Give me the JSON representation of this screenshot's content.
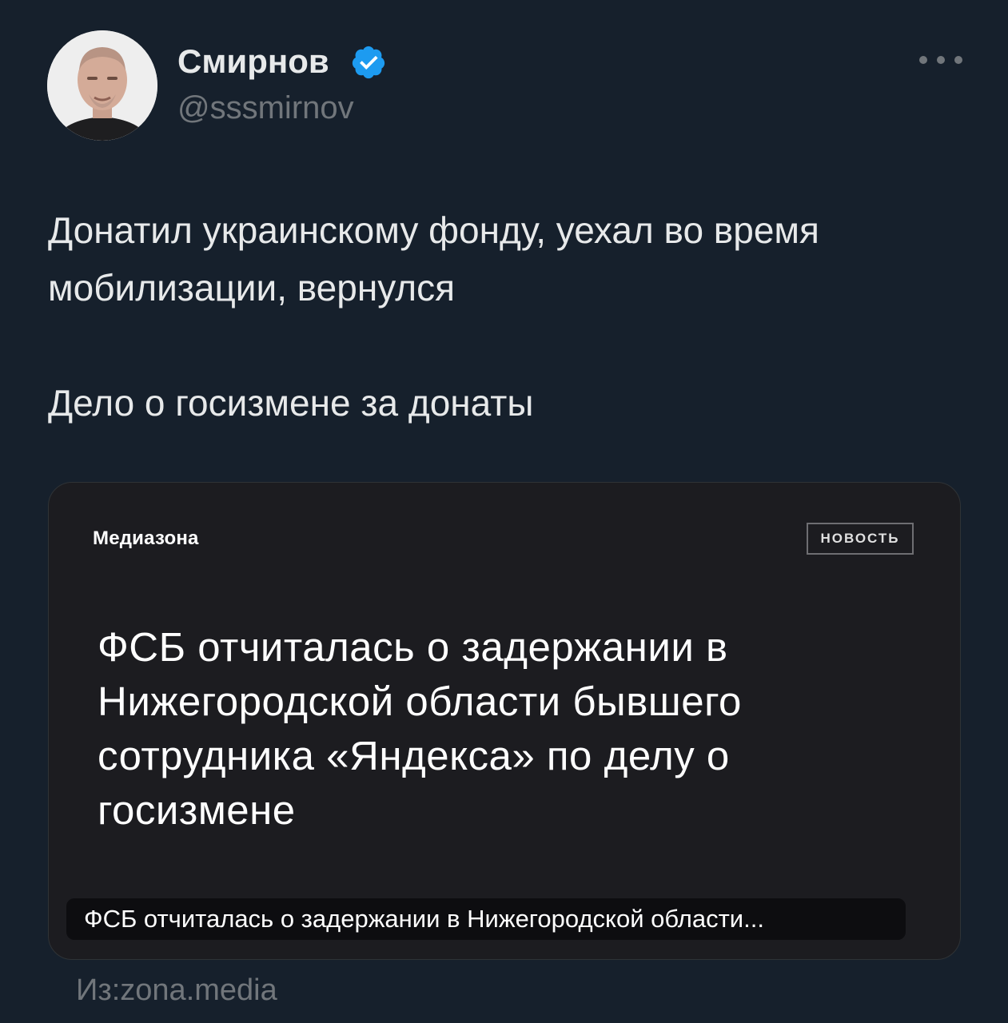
{
  "author": {
    "display_name": "Смирнов",
    "handle": "@sssmirnov",
    "verified": true,
    "avatar_icon": "avatar-photo"
  },
  "tweet": {
    "text_line1": "Донатил украинскому фонду, уехал во время мобилизации, вернулся",
    "text_line2": "Дело о госизмене за донаты"
  },
  "card": {
    "brand": "Медиазона",
    "badge": "НОВОСТЬ",
    "headline": "ФСБ отчиталась о задержании в Нижегородской области бывшего сотрудника «Яндекса» по делу о госизмене",
    "overlay_title": "ФСБ отчиталась о задержании в Нижегородской области...",
    "source": "Из:zona.media"
  },
  "colors": {
    "background": "#16202c",
    "verified_blue": "#1d9bf0",
    "muted_text": "#71767b",
    "card_background": "#1c1c20"
  }
}
